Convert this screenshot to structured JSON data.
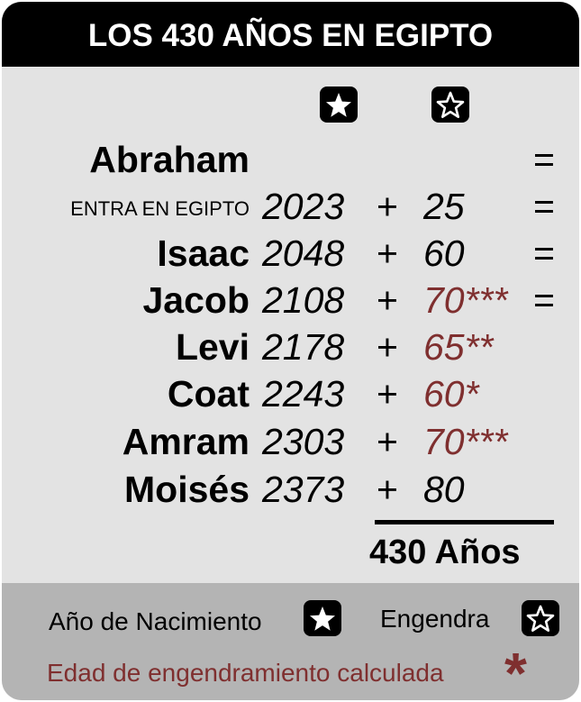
{
  "title": "LOS 430 AÑOS EN EGIPTO",
  "header_icons": [
    "filled-star-icon",
    "outlined-star-icon"
  ],
  "rows": [
    {
      "name": "Abraham",
      "year": "",
      "plus": "",
      "age": "",
      "eq": "="
    },
    {
      "name": "ENTRA EN EGIPTO",
      "year": "2023",
      "plus": "+",
      "age": "25",
      "eq": "="
    },
    {
      "name": "Isaac",
      "year": "2048",
      "plus": "+",
      "age": "60",
      "eq": "="
    },
    {
      "name": "Jacob",
      "year": "2108",
      "plus": "+",
      "age": "70***",
      "eq": "="
    },
    {
      "name": "Levi",
      "year": "2178",
      "plus": "+",
      "age": "65**",
      "eq": ""
    },
    {
      "name": "Coat",
      "year": "2243",
      "plus": "+",
      "age": "60*",
      "eq": ""
    },
    {
      "name": "Amram",
      "year": "2303",
      "plus": "+",
      "age": "70***",
      "eq": ""
    },
    {
      "name": "Moisés",
      "year": "2373",
      "plus": "+",
      "age": "80",
      "eq": ""
    }
  ],
  "total": "430 Años",
  "legend": {
    "birth_year": "Año de Nacimiento",
    "begets": "Engendra",
    "calculated": "Edad de engendramiento calculada",
    "asterisk": "*"
  },
  "colors": {
    "background": "#e3e3e3",
    "title_bar": "#000000",
    "footer": "#b4b4b4",
    "calculated": "#7f2f2f"
  }
}
